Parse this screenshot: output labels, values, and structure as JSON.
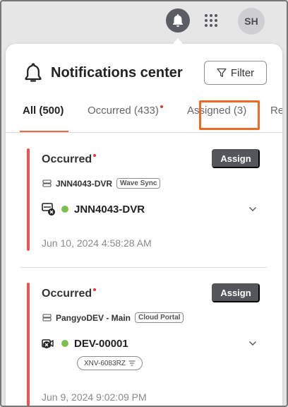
{
  "topbar": {
    "avatar_initials": "SH",
    "icons": [
      "bell-icon",
      "apps-grid-icon"
    ]
  },
  "panel": {
    "title": "Notifications center",
    "filter_label": "Filter",
    "tabs": [
      {
        "label": "All (500)",
        "active": true,
        "has_dot": false
      },
      {
        "label": "Occurred (433)",
        "active": false,
        "has_dot": true
      },
      {
        "label": "Assigned (3)",
        "active": false,
        "has_dot": false
      },
      {
        "label": "Re",
        "active": false,
        "has_dot": false
      }
    ]
  },
  "notifications": [
    {
      "status": "Occurred",
      "assign_label": "Assign",
      "source_name": "JNN4043-DVR",
      "source_tag": "Wave Sync",
      "device_name": "JNN4043-DVR",
      "device_icon": "recorder-error-icon",
      "model": "",
      "timestamp": "Jun 10, 2024 4:58:28 AM"
    },
    {
      "status": "Occurred",
      "assign_label": "Assign",
      "source_name": "PangyoDEV - Main",
      "source_tag": "Cloud Portal",
      "device_name": "DEV-00001",
      "device_icon": "camera-error-icon",
      "model": "XNV-6083RZ",
      "timestamp": "Jun 9, 2024 9:02:09 PM"
    }
  ],
  "colors": {
    "accent": "#e8693d",
    "status_bar": "#ea5455",
    "online": "#7cc04b",
    "button_dark": "#54565b"
  }
}
